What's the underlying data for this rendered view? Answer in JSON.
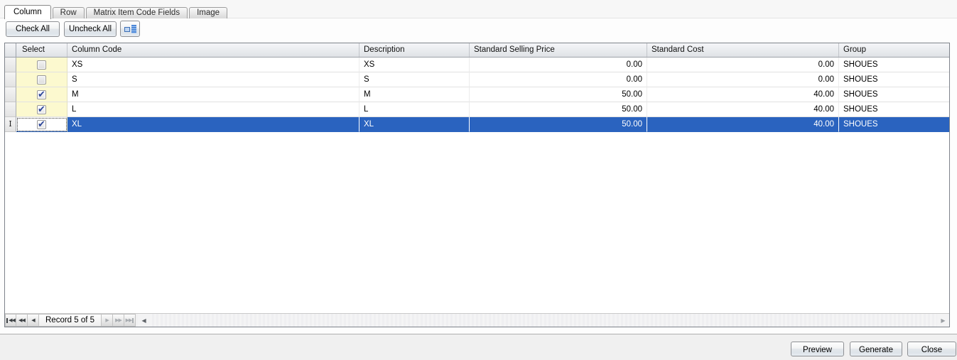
{
  "tabs": {
    "items": [
      {
        "label": "Column",
        "active": true
      },
      {
        "label": "Row",
        "active": false
      },
      {
        "label": "Matrix Item Code Fields",
        "active": false
      },
      {
        "label": "Image",
        "active": false
      }
    ]
  },
  "toolbar": {
    "check_all_label": "Check All",
    "uncheck_all_label": "Uncheck All",
    "view_icon": "list-detail-icon"
  },
  "grid": {
    "columns": {
      "select": "Select",
      "column_code": "Column Code",
      "description": "Description",
      "standard_selling_price": "Standard Selling Price",
      "standard_cost": "Standard Cost",
      "group": "Group"
    },
    "rows": [
      {
        "checked": false,
        "selected": false,
        "column_code": "XS",
        "description": "XS",
        "standard_selling_price": "0.00",
        "standard_cost": "0.00",
        "group": "SHOUES"
      },
      {
        "checked": false,
        "selected": false,
        "column_code": "S",
        "description": "S",
        "standard_selling_price": "0.00",
        "standard_cost": "0.00",
        "group": "SHOUES"
      },
      {
        "checked": true,
        "selected": false,
        "column_code": "M",
        "description": "M",
        "standard_selling_price": "50.00",
        "standard_cost": "40.00",
        "group": "SHOUES"
      },
      {
        "checked": true,
        "selected": false,
        "column_code": "L",
        "description": "L",
        "standard_selling_price": "50.00",
        "standard_cost": "40.00",
        "group": "SHOUES"
      },
      {
        "checked": true,
        "selected": true,
        "column_code": "XL",
        "description": "XL",
        "standard_selling_price": "50.00",
        "standard_cost": "40.00",
        "group": "SHOUES"
      }
    ],
    "navigator": {
      "record_label": "Record 5 of 5"
    }
  },
  "footer": {
    "preview_label": "Preview",
    "generate_label": "Generate",
    "close_label": "Close"
  },
  "colors": {
    "selection_blue": "#2A63BF",
    "select_column_yellow": "#FCF9CF",
    "check_mark_blue": "#2D4699"
  }
}
